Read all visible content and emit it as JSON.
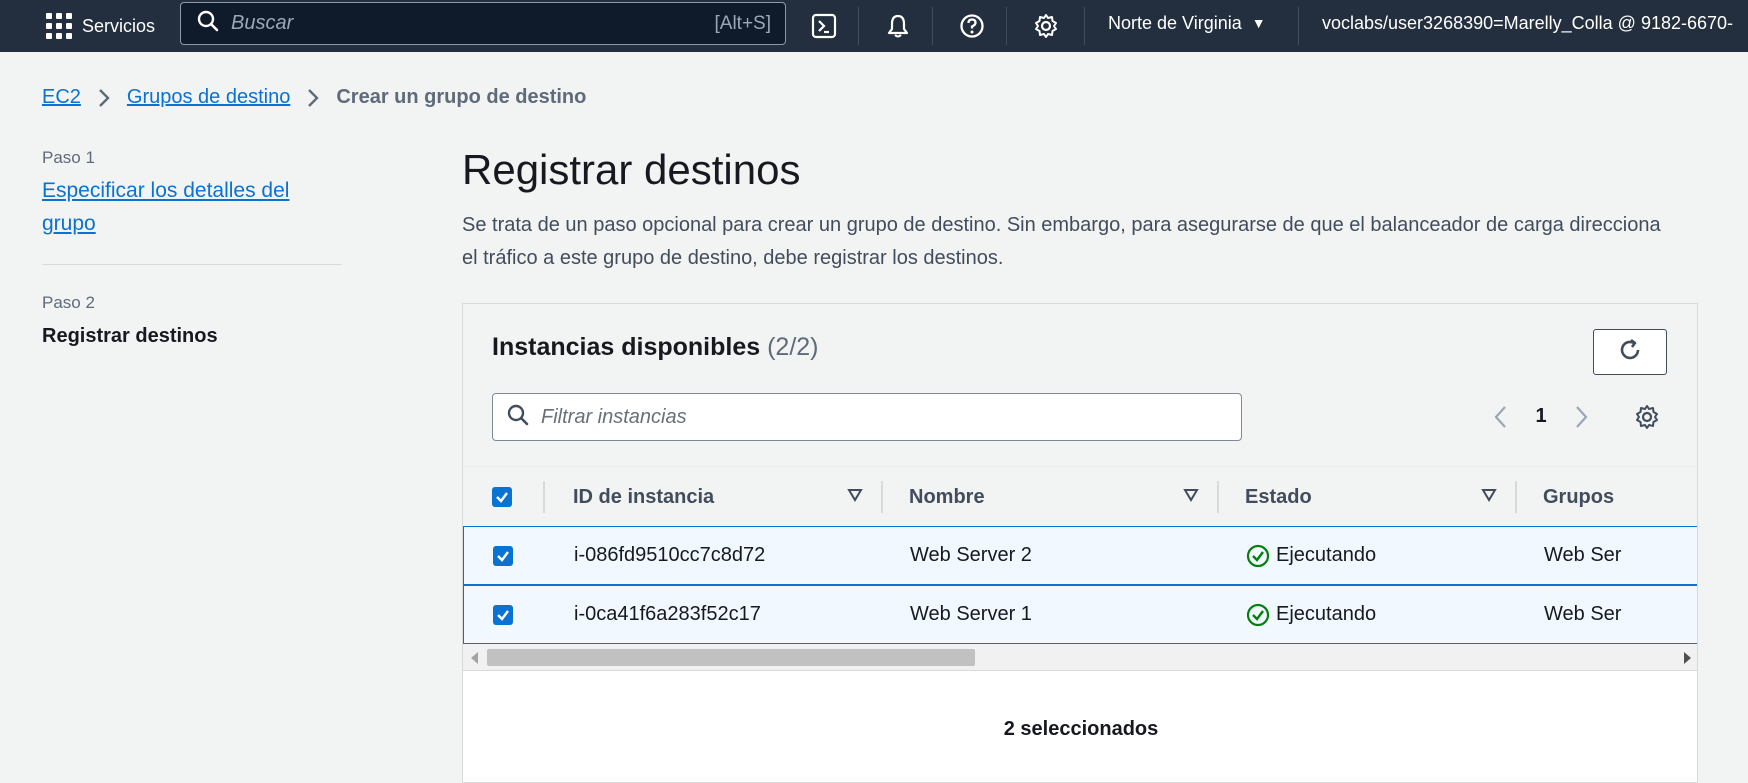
{
  "topnav": {
    "services_label": "Servicios",
    "search_placeholder": "Buscar",
    "search_shortcut": "[Alt+S]",
    "region": "Norte de Virginia",
    "account": "voclabs/user3268390=Marelly_Colla @ 9182-6670-"
  },
  "breadcrumb": {
    "items": [
      "EC2",
      "Grupos de destino"
    ],
    "current": "Crear un grupo de destino"
  },
  "steps": [
    {
      "label": "Paso 1",
      "title": "Especificar los detalles del grupo"
    },
    {
      "label": "Paso 2",
      "title": "Registrar destinos"
    }
  ],
  "main": {
    "title": "Registrar destinos",
    "description": "Se trata de un paso opcional para crear un grupo de destino. Sin embargo, para asegurarse de que el balanceador de carga direcciona el tráfico a este grupo de destino, debe registrar los destinos."
  },
  "panel": {
    "title": "Instancias disponibles",
    "count": "(2/2)",
    "filter_placeholder": "Filtrar instancias",
    "page": "1",
    "columns": [
      "ID de instancia",
      "Nombre",
      "Estado",
      "Grupos"
    ],
    "rows": [
      {
        "id": "i-086fd9510cc7c8d72",
        "name": "Web Server 2",
        "state": "Ejecutando",
        "group": "Web Ser"
      },
      {
        "id": "i-0ca41f6a283f52c17",
        "name": "Web Server 1",
        "state": "Ejecutando",
        "group": "Web Ser"
      }
    ],
    "selected_text": "2 seleccionados"
  },
  "colors": {
    "nav_bg": "#232f3e",
    "link": "#0972d3",
    "success": "#037f0c",
    "selected_row_bg": "#f1f8ff"
  }
}
